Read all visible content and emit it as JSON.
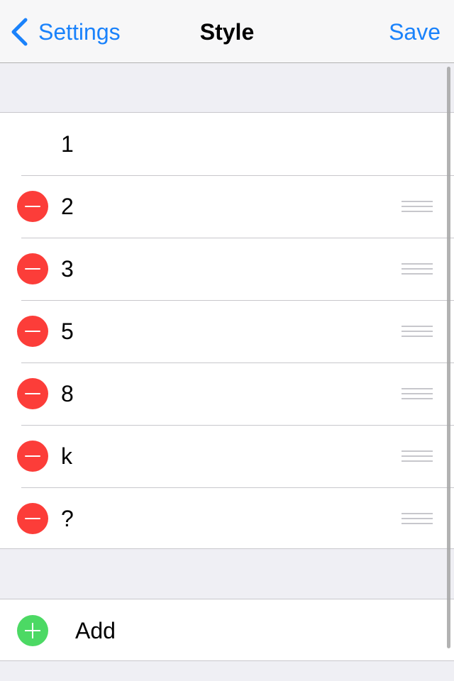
{
  "navbar": {
    "back_label": "Settings",
    "title": "Style",
    "save_label": "Save",
    "accent_color": "#1a82fb"
  },
  "list": {
    "items": [
      {
        "label": "1",
        "deletable": false,
        "reorderable": false
      },
      {
        "label": "2",
        "deletable": true,
        "reorderable": true
      },
      {
        "label": "3",
        "deletable": true,
        "reorderable": true
      },
      {
        "label": "5",
        "deletable": true,
        "reorderable": true
      },
      {
        "label": "8",
        "deletable": true,
        "reorderable": true
      },
      {
        "label": "k",
        "deletable": true,
        "reorderable": true
      },
      {
        "label": "?",
        "deletable": true,
        "reorderable": true
      }
    ],
    "delete_color": "#fc3d39",
    "delete_icon": "minus-circle-icon",
    "reorder_icon": "reorder-handle-icon"
  },
  "add": {
    "label": "Add",
    "color": "#4cd964",
    "icon": "plus-circle-icon"
  }
}
